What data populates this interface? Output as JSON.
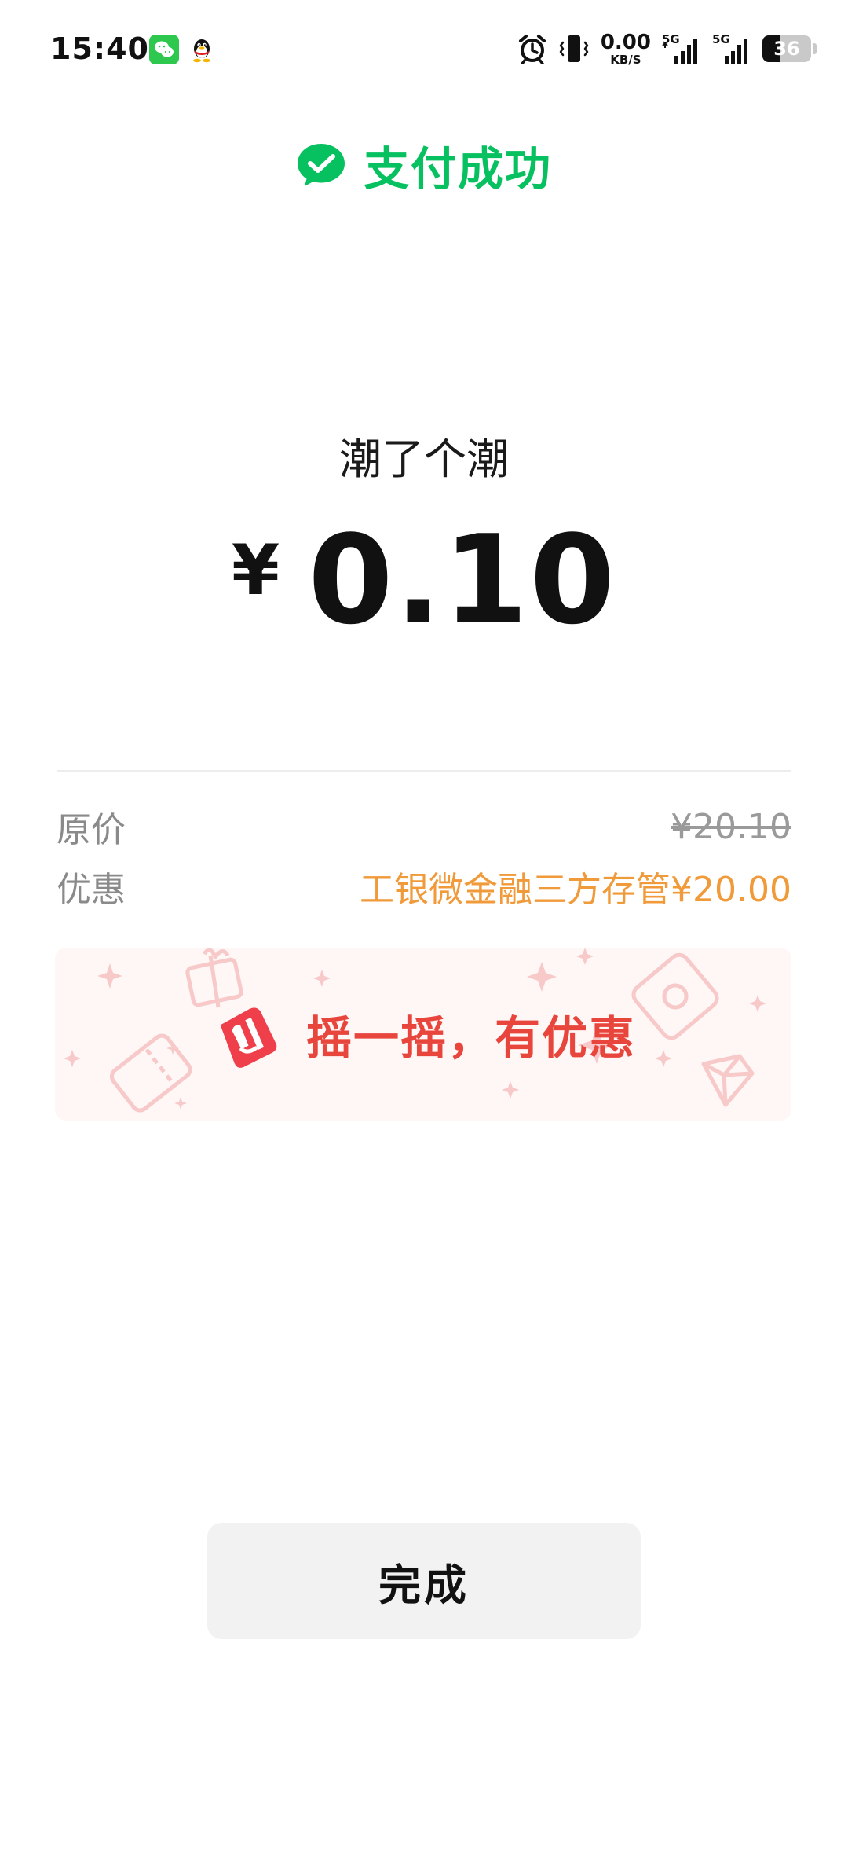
{
  "status_bar": {
    "time": "15:40",
    "net_speed_value": "0.00",
    "net_speed_unit": "KB/S",
    "signal_1_label": "5G",
    "signal_2_label": "5G",
    "battery_level": "36",
    "battery_fraction": 0.36,
    "icons": [
      "wechat-app-icon",
      "qq-app-icon",
      "alarm-icon",
      "vibrate-icon",
      "signal-icon",
      "battery-icon"
    ]
  },
  "header": {
    "title": "支付成功"
  },
  "payment": {
    "merchant": "潮了个潮",
    "currency_symbol": "¥",
    "amount": "0.10"
  },
  "details": {
    "original_label": "原价",
    "original_value": "¥20.10",
    "discount_label": "优惠",
    "discount_value": "工银微金融三方存管¥20.00"
  },
  "banner": {
    "text": "摇一摇，有优惠"
  },
  "done_button": {
    "label": "完成"
  },
  "colors": {
    "brand_green": "#07c160",
    "discount_orange": "#f09a3a",
    "banner_red": "#e8453c",
    "banner_bg": "#fff6f6",
    "button_bg": "#f2f2f2"
  }
}
